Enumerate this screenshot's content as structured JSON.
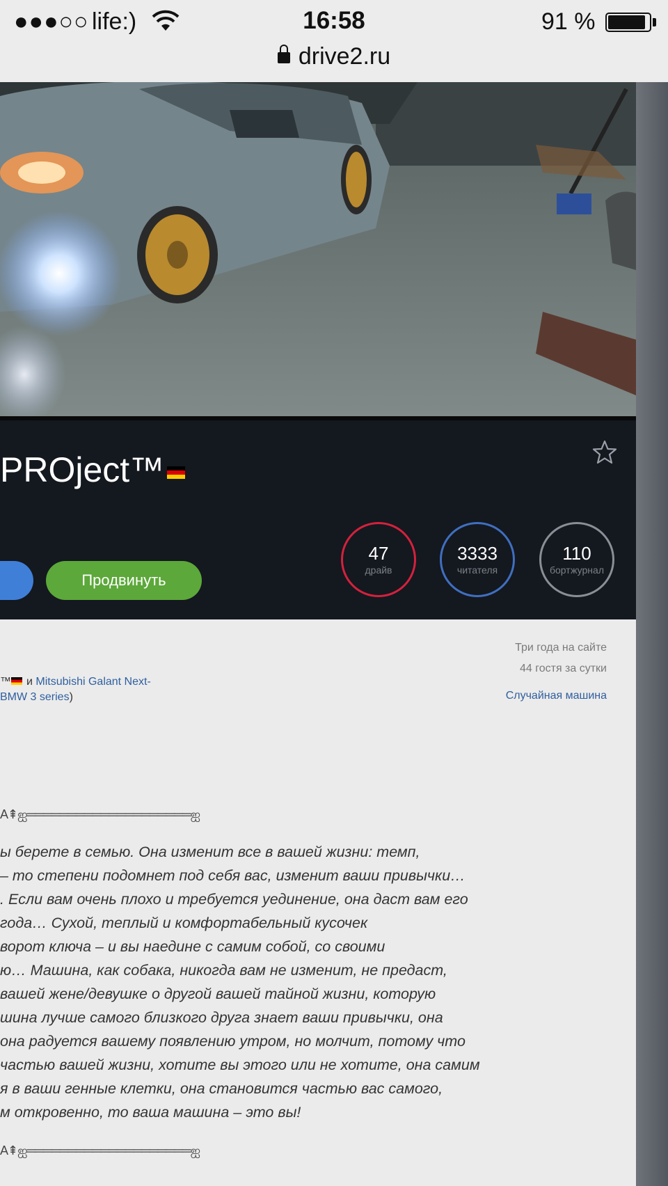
{
  "status_bar": {
    "signal": "●●●○○",
    "carrier": "life:)",
    "time": "16:58",
    "battery": "91 %",
    "battery_level": 0.91,
    "url": "drive2.ru"
  },
  "profile": {
    "title": "PROject™",
    "promote_label": "Продвинуть",
    "stats": [
      {
        "value": "47",
        "label": "драйв",
        "color": "#d4213d"
      },
      {
        "value": "3333",
        "label": "читателя",
        "color": "#3f6fc0"
      },
      {
        "value": "110",
        "label": "бортжурнал",
        "color": "#8a8e96"
      }
    ]
  },
  "info": {
    "years_on_site": "Три года на сайте",
    "guests": "44 гостя за сутки",
    "random_car": "Случайная машина",
    "car_line1_a": "™",
    "car_line1_and": "и",
    "car_line1_link": "Mitsubishi Galant Next-",
    "car_line2_link": "BMW 3 series",
    "car_line2_close": ")"
  },
  "separator": "A⇞ஐ════════════════════ஐ",
  "story_lines": [
    "ы берете в семью. Она изменит все в вашей жизни: темп,",
    "– то степени подомнет под себя вас, изменит ваши привычки…",
    ". Если вам очень плохо и требуется уединение, она даст вам его",
    " года… Сухой, теплый и комфортабельный кусочек",
    "ворот ключа – и вы наедине с самим собой, со своими",
    "ю… Машина, как собака, никогда вам не изменит, не предаст,",
    " вашей жене/девушке о другой вашей тайной жизни, которую",
    "шина лучше самого близкого друга знает ваши привычки, она",
    "она радуется вашему появлению утром, но молчит, потому что",
    "частью вашей жизни, хотите вы этого или не хотите, она самим",
    "я в ваши генные клетки, она становится частью вас самого,",
    "м откровенно, то ваша машина – это вы!"
  ]
}
